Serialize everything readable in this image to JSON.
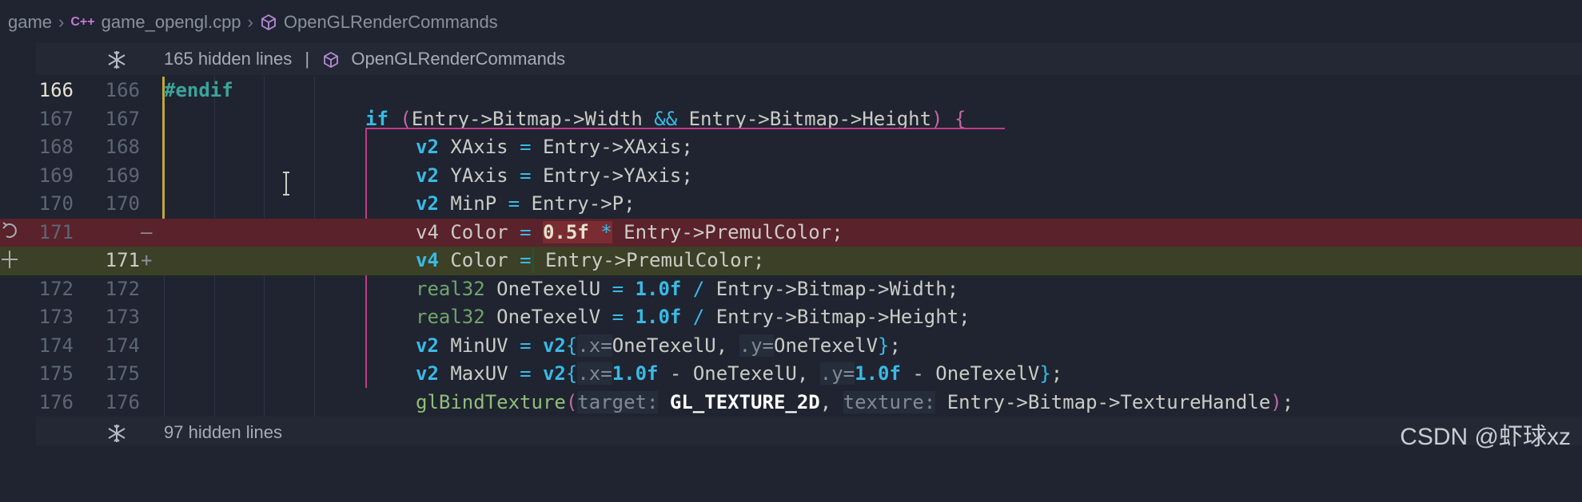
{
  "breadcrumb": {
    "items": [
      "game",
      "game_opengl.cpp",
      "OpenGLRenderCommands"
    ],
    "cpp_badge": "C++"
  },
  "folds": {
    "top": {
      "text": "165 hidden lines",
      "separator": "|",
      "symbol": "OpenGLRenderCommands"
    },
    "bottom": {
      "text": "97 hidden lines"
    }
  },
  "lines": [
    {
      "old": "166",
      "new": "166",
      "mark": ""
    },
    {
      "old": "167",
      "new": "167",
      "mark": ""
    },
    {
      "old": "168",
      "new": "168",
      "mark": ""
    },
    {
      "old": "169",
      "new": "169",
      "mark": ""
    },
    {
      "old": "170",
      "new": "170",
      "mark": ""
    },
    {
      "old": "171",
      "new": "",
      "mark": "—"
    },
    {
      "old": "",
      "new": "171",
      "mark": "+"
    },
    {
      "old": "172",
      "new": "172",
      "mark": ""
    },
    {
      "old": "173",
      "new": "173",
      "mark": ""
    },
    {
      "old": "174",
      "new": "174",
      "mark": ""
    },
    {
      "old": "175",
      "new": "175",
      "mark": ""
    },
    {
      "old": "176",
      "new": "176",
      "mark": ""
    }
  ],
  "code": {
    "l166": {
      "pre": "#endif"
    },
    "l167": {
      "if": "if",
      "p1": "(",
      "a": "Entry->Bitmap->Width ",
      "and": "&&",
      "b": " Entry->Bitmap->Height",
      "p2": ")",
      "brace": "{"
    },
    "l168": {
      "type": "v2",
      "name": " XAxis ",
      "eq": "=",
      "rest": " Entry->XAxis;"
    },
    "l169": {
      "type": "v2",
      "name": " YAxis ",
      "eq": "=",
      "rest": " Entry->YAxis;"
    },
    "l170": {
      "type": "v2",
      "name": " MinP ",
      "eq": "=",
      "rest": " Entry->P;"
    },
    "l171del": {
      "type": "v4",
      "name": " Color ",
      "eq": "=",
      "sp": " ",
      "num": "0.5f",
      "mul": " *",
      "rest": " Entry->PremulColor;"
    },
    "l171add": {
      "type": "v4",
      "name": " Color ",
      "eq": "=",
      "rest": " Entry->PremulColor;"
    },
    "l172": {
      "type": "real32",
      "name": " OneTexelU ",
      "eq": "=",
      "num": " 1.0f",
      "div": " /",
      "rest": " Entry->Bitmap->Width;"
    },
    "l173": {
      "type": "real32",
      "name": " OneTexelV ",
      "eq": "=",
      "num": " 1.0f",
      "div": " /",
      "rest": " Entry->Bitmap->Height;"
    },
    "l174": {
      "type": "v2",
      "name": " MinUV ",
      "eq": "=",
      "ctor": " v2",
      "ob": "{",
      "hx": ".x=",
      "vx": "OneTexelU, ",
      "hy": ".y=",
      "vy": "OneTexelV",
      "cb": "}",
      "semi": ";"
    },
    "l175": {
      "type": "v2",
      "name": " MaxUV ",
      "eq": "=",
      "ctor": " v2",
      "ob": "{",
      "hx": ".x=",
      "nx": "1.0f",
      "mx": " - OneTexelU, ",
      "hy": ".y=",
      "ny": "1.0f",
      "my": " - OneTexelV",
      "cb": "}",
      "semi": ";"
    },
    "l176": {
      "func": "glBindTexture",
      "op": "(",
      "h1": "target:",
      "c1": "GL_TEXTURE_2D",
      "comma": ", ",
      "h2": "texture:",
      "arg2": "Entry->Bitmap->TextureHandle",
      "cp": ")",
      "semi": ";"
    }
  },
  "watermark": "CSDN @虾球xz",
  "colors": {
    "background": "#1f2430",
    "deleted_line": "#5a222a",
    "added_line": "#3b4026",
    "keyword": "#39bae6",
    "scope_bracket": "#c33a8a"
  },
  "icons": [
    "cpp-file-icon",
    "symbol-cube-icon",
    "fold-expand-icon",
    "text-cursor-icon",
    "revert-change-icon",
    "add-change-icon"
  ]
}
